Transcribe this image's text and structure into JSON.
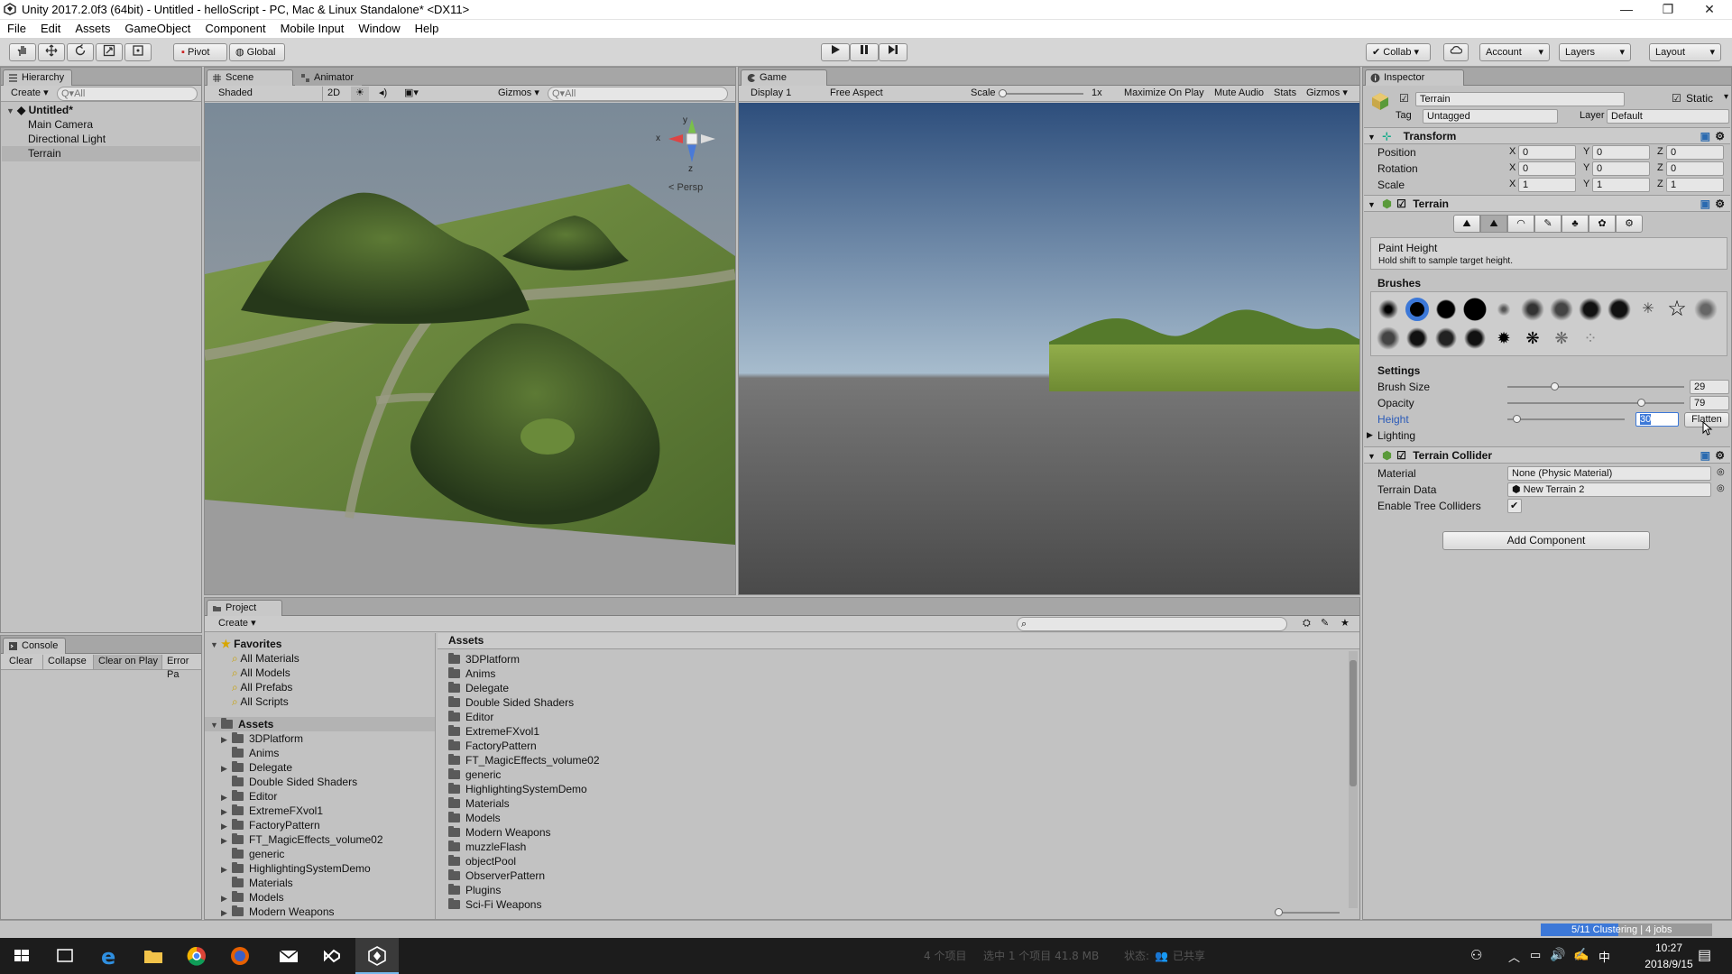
{
  "window": {
    "title": "Unity 2017.2.0f3 (64bit) - Untitled - helloScript - PC, Mac & Linux Standalone* <DX11>",
    "min": "—",
    "max": "❐",
    "close": "✕"
  },
  "menu": [
    "File",
    "Edit",
    "Assets",
    "GameObject",
    "Component",
    "Mobile Input",
    "Window",
    "Help"
  ],
  "toolbar": {
    "pivot": "Pivot",
    "global": "Global",
    "collab": "Collab ▾",
    "account": "Account",
    "layers": "Layers",
    "layout": "Layout"
  },
  "hierarchy": {
    "tab": "Hierarchy",
    "create": "Create ▾",
    "search_placeholder": "Q▾All",
    "scene": "Untitled*",
    "items": [
      "Main Camera",
      "Directional Light",
      "Terrain"
    ]
  },
  "scene": {
    "tab": "Scene",
    "animator_tab": "Animator",
    "shaded": "Shaded",
    "mode2d": "2D",
    "gizmos": "Gizmos ▾",
    "search_placeholder": "Q▾All",
    "persp": "< Persp",
    "axis_y": "y",
    "axis_x": "x",
    "axis_z": "z"
  },
  "game": {
    "tab": "Game",
    "display": "Display 1",
    "aspect": "Free Aspect",
    "scale_label": "Scale",
    "scale_value": "1x",
    "max_on_play": "Maximize On Play",
    "mute": "Mute Audio",
    "stats": "Stats",
    "gizmos": "Gizmos ▾"
  },
  "inspector": {
    "tab": "Inspector",
    "object_name": "Terrain",
    "static_label": "Static",
    "tag_label": "Tag",
    "tag_value": "Untagged",
    "layer_label": "Layer",
    "layer_value": "Default",
    "transform": {
      "title": "Transform",
      "rows": [
        {
          "label": "Position",
          "x": "0",
          "y": "0",
          "z": "0"
        },
        {
          "label": "Rotation",
          "x": "0",
          "y": "0",
          "z": "0"
        },
        {
          "label": "Scale",
          "x": "1",
          "y": "1",
          "z": "1"
        }
      ],
      "axis_x": "X",
      "axis_y": "Y",
      "axis_z": "Z"
    },
    "terrain": {
      "title": "Terrain",
      "tool_title": "Paint Height",
      "tool_hint": "Hold shift to sample target height.",
      "brushes_label": "Brushes",
      "settings_label": "Settings",
      "brush_size_label": "Brush Size",
      "brush_size": "29",
      "opacity_label": "Opacity",
      "opacity": "79",
      "height_label": "Height",
      "height": "30",
      "flatten": "Flatten",
      "lighting_label": "Lighting"
    },
    "collider": {
      "title": "Terrain Collider",
      "material_label": "Material",
      "material_value": "None (Physic Material)",
      "terrain_data_label": "Terrain Data",
      "terrain_data_value": "New Terrain 2",
      "tree_colliders_label": "Enable Tree Colliders"
    },
    "add_component": "Add Component"
  },
  "console": {
    "tab": "Console",
    "clear": "Clear",
    "collapse": "Collapse",
    "clear_on_play": "Clear on Play",
    "error_pause": "Error Pa"
  },
  "project": {
    "tab": "Project",
    "create": "Create ▾",
    "favorites_label": "Favorites",
    "favorites": [
      "All Materials",
      "All Models",
      "All Prefabs",
      "All Scripts"
    ],
    "assets_label": "Assets",
    "tree": [
      {
        "name": "3DPlatform",
        "arrow": true
      },
      {
        "name": "Anims",
        "arrow": false
      },
      {
        "name": "Delegate",
        "arrow": true
      },
      {
        "name": "Double Sided Shaders",
        "arrow": false
      },
      {
        "name": "Editor",
        "arrow": true
      },
      {
        "name": "ExtremeFXvol1",
        "arrow": true
      },
      {
        "name": "FactoryPattern",
        "arrow": true
      },
      {
        "name": "FT_MagicEffects_volume02",
        "arrow": true
      },
      {
        "name": "generic",
        "arrow": false
      },
      {
        "name": "HighlightingSystemDemo",
        "arrow": true
      },
      {
        "name": "Materials",
        "arrow": false
      },
      {
        "name": "Models",
        "arrow": true
      },
      {
        "name": "Modern Weapons",
        "arrow": true
      }
    ],
    "grid_header": "Assets",
    "grid": [
      "3DPlatform",
      "Anims",
      "Delegate",
      "Double Sided Shaders",
      "Editor",
      "ExtremeFXvol1",
      "FactoryPattern",
      "FT_MagicEffects_volume02",
      "generic",
      "HighlightingSystemDemo",
      "Materials",
      "Models",
      "Modern Weapons",
      "muzzleFlash",
      "objectPool",
      "ObserverPattern",
      "Plugins",
      "Sci-Fi Weapons"
    ]
  },
  "status": {
    "progress_text": "5/11 Clustering | 4 jobs",
    "progress": 0.45
  },
  "taskbar": {
    "info_items": "4 个项目",
    "info_selected": "选中 1 个项目  41.8 MB",
    "info_state": "状态:",
    "info_shared": "已共享",
    "ime": "中",
    "time": "10:27",
    "date": "2018/9/15"
  },
  "colors": {
    "accent": "#3c78d8",
    "panel": "#c2c2c2",
    "tabbar": "#a6a6a6",
    "taskbar": "#1c1c1c"
  }
}
